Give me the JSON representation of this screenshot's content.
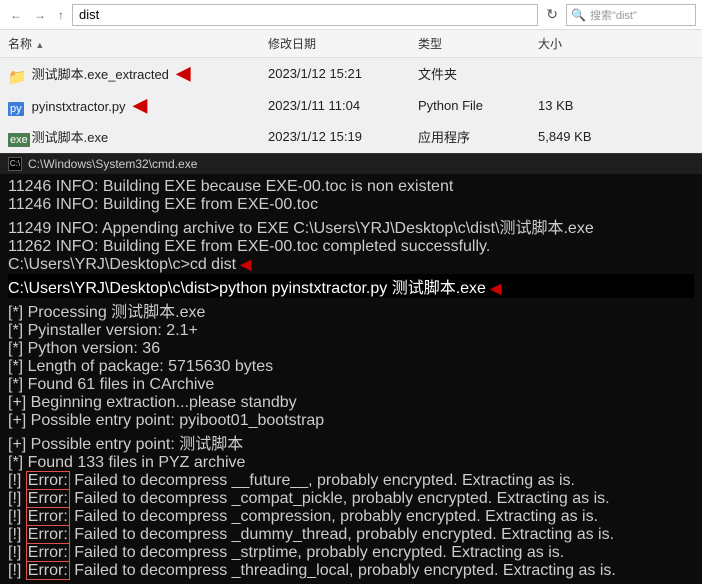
{
  "explorer": {
    "path": "dist",
    "search_placeholder": "搜索\"dist\"",
    "columns": {
      "name": "名称",
      "date": "修改日期",
      "type": "类型",
      "size": "大小"
    },
    "files": [
      {
        "name": "测试脚本.exe_extracted",
        "date": "2023/1/12 15:21",
        "type": "文件夹",
        "size": "",
        "icon": "folder",
        "has_arrow": true
      },
      {
        "name": "pyinstxtractor.py",
        "date": "2023/1/11 11:04",
        "type": "Python File",
        "size": "13 KB",
        "icon": "py",
        "has_arrow": true
      },
      {
        "name": "测试脚本.exe",
        "date": "2023/1/12 15:19",
        "type": "应用程序",
        "size": "5,849 KB",
        "icon": "exe",
        "has_arrow": false
      }
    ]
  },
  "cmd": {
    "title": "C:\\Windows\\System32\\cmd.exe",
    "lines": [
      {
        "text": "11246 INFO: Building EXE because EXE-00.toc is non existent",
        "type": "normal"
      },
      {
        "text": "11246 INFO: Building EXE from EXE-00.toc",
        "type": "normal"
      },
      {
        "text": "11249 INFO: Appending archive to EXE C:\\Users\\YRJ\\Desktop\\c\\dist\\测试脚本.exe",
        "type": "normal"
      },
      {
        "text": "11262 INFO: Building EXE from EXE-00.toc completed successfully.",
        "type": "normal"
      },
      {
        "text": "",
        "type": "normal"
      },
      {
        "text": "C:\\Users\\YRJ\\Desktop\\c>cd dist",
        "type": "prompt",
        "has_arrow": true
      },
      {
        "text": "",
        "type": "normal"
      },
      {
        "text": "C:\\Users\\YRJ\\Desktop\\c\\dist>python pyinstxtractor.py 测试脚本.exe",
        "type": "prompt_input",
        "has_arrow": true
      },
      {
        "text": "[*] Processing 测试脚本.exe",
        "type": "normal"
      },
      {
        "text": "[*] Pyinstaller version: 2.1+",
        "type": "normal"
      },
      {
        "text": "[*] Python version: 36",
        "type": "normal"
      },
      {
        "text": "[*] Length of package: 5715630 bytes",
        "type": "normal"
      },
      {
        "text": "[*] Found 61 files in CArchive",
        "type": "normal"
      },
      {
        "text": "[+] Beginning extraction...please standby",
        "type": "normal"
      },
      {
        "text": "[+] Possible entry point: pyiboot01_bootstrap",
        "type": "normal"
      },
      {
        "text": "[+] Possible entry point: 测试脚本",
        "type": "normal"
      },
      {
        "text": "[*] Found 133 files in PYZ archive",
        "type": "normal"
      },
      {
        "text": "[!] Error: Failed to decompress __future__, probably encrypted. Extracting as is.",
        "type": "error"
      },
      {
        "text": "[!] Error: Failed to decompress _compat_pickle, probably encrypted. Extracting as is.",
        "type": "error"
      },
      {
        "text": "[!] Error: Failed to decompress _compression, probably encrypted. Extracting as is.",
        "type": "error"
      },
      {
        "text": "[!] Error: Failed to decompress _dummy_thread, probably encrypted. Extracting as is.",
        "type": "error"
      },
      {
        "text": "[!] Error: Failed to decompress _strptime, probably encrypted. Extracting as is.",
        "type": "error"
      },
      {
        "text": "[!] Error: Failed to decompress _threading_local, probably encrypted. Extracting as is.",
        "type": "error"
      }
    ]
  }
}
